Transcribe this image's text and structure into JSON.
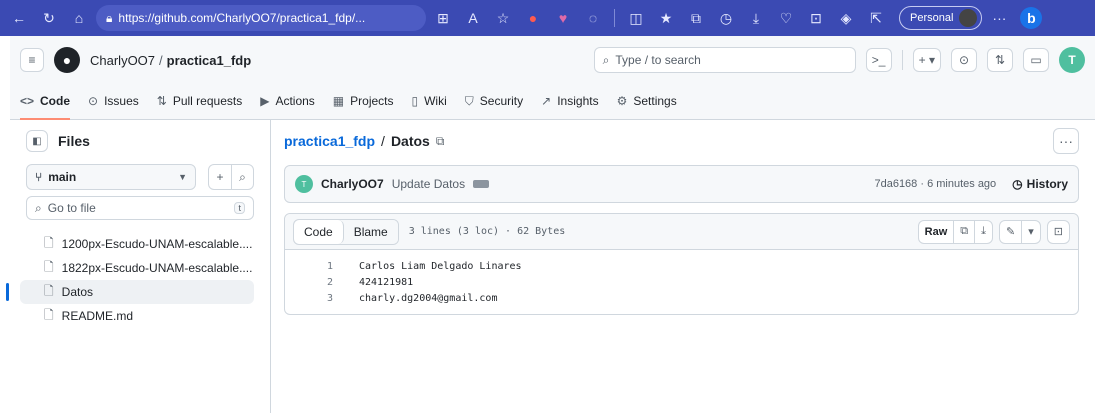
{
  "browser": {
    "url": "https://github.com/CharlyOO7/practica1_fdp/...",
    "profile_label": "Personal"
  },
  "header": {
    "owner": "CharlyOO7",
    "repo": "practica1_fdp",
    "search_placeholder": "Type / to search",
    "search_key": "/",
    "avatar_text": "T"
  },
  "tabs": [
    {
      "label": "Code",
      "icon": "code-icon"
    },
    {
      "label": "Issues",
      "icon": "issue-icon"
    },
    {
      "label": "Pull requests",
      "icon": "pull-request-icon"
    },
    {
      "label": "Actions",
      "icon": "play-icon"
    },
    {
      "label": "Projects",
      "icon": "table-icon"
    },
    {
      "label": "Wiki",
      "icon": "book-icon"
    },
    {
      "label": "Security",
      "icon": "shield-icon"
    },
    {
      "label": "Insights",
      "icon": "graph-icon"
    },
    {
      "label": "Settings",
      "icon": "gear-icon"
    }
  ],
  "sidebar": {
    "title": "Files",
    "branch": "main",
    "goto_placeholder": "Go to file",
    "goto_key": "t",
    "files": [
      {
        "name": "1200px-Escudo-UNAM-escalable...."
      },
      {
        "name": "1822px-Escudo-UNAM-escalable...."
      },
      {
        "name": "Datos"
      },
      {
        "name": "README.md"
      }
    ]
  },
  "main": {
    "repo_link": "practica1_fdp",
    "path_sep": "/",
    "file_name": "Datos",
    "commit": {
      "author": "CharlyOO7",
      "message": "Update Datos",
      "sha_time": "7da6168 · 6 minutes ago",
      "history_label": "History"
    },
    "file": {
      "code_tab": "Code",
      "blame_tab": "Blame",
      "meta": "3 lines (3 loc) · 62 Bytes",
      "raw_label": "Raw",
      "lines": [
        {
          "num": "1",
          "text": "Carlos Liam Delgado Linares"
        },
        {
          "num": "2",
          "text": "424121981"
        },
        {
          "num": "3",
          "text": "charly.dg2004@gmail.com"
        }
      ]
    }
  }
}
